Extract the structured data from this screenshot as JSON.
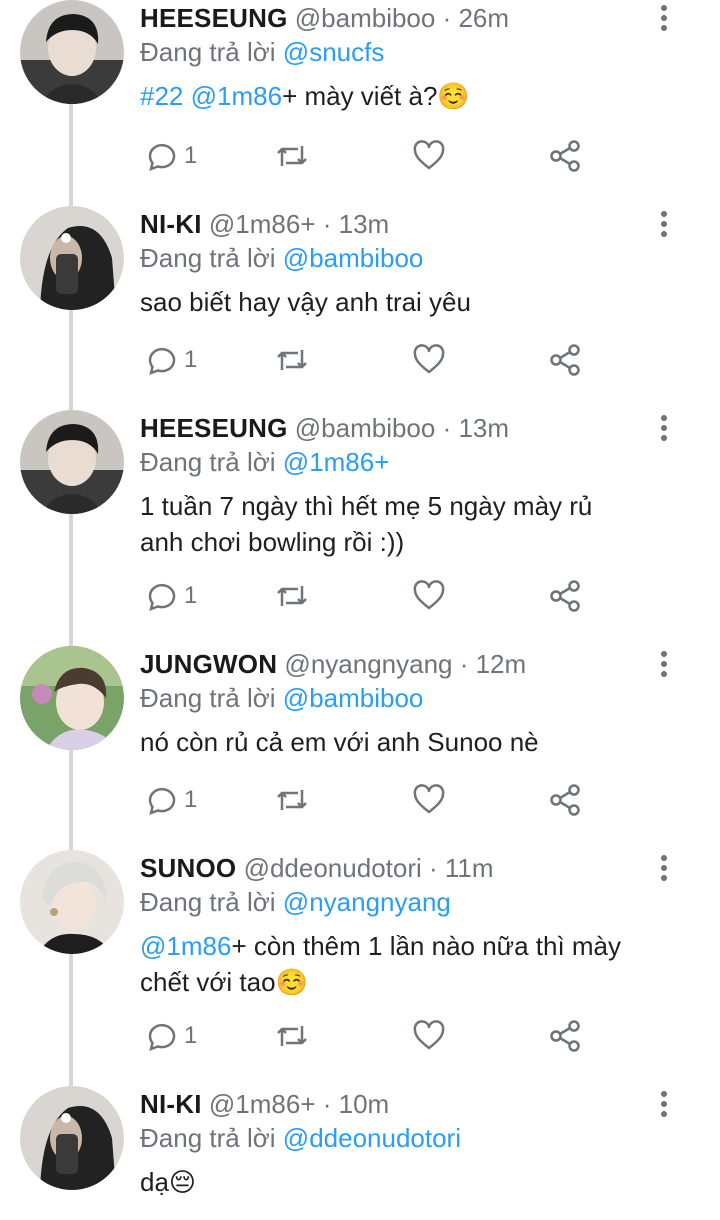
{
  "tweets": [
    {
      "name": "HEESEUNG",
      "handle": "@bambiboo · 26m",
      "reply_prefix": "Đang trả lời",
      "reply_to": "@snucfs",
      "body_hashtag": "#22",
      "body_mention": "@1m86",
      "body_text": "+ mày viết à?☺️",
      "reply_count": "1",
      "avatar": "person-avatar"
    },
    {
      "name": "NI-KI",
      "handle": "@1m86+ · 13m",
      "reply_prefix": "Đang trả lời",
      "reply_to": "@bambiboo",
      "body_text": "sao biết hay vậy anh trai yêu",
      "reply_count": "1",
      "avatar": "person-avatar"
    },
    {
      "name": "HEESEUNG",
      "handle": "@bambiboo · 13m",
      "reply_prefix": "Đang trả lời",
      "reply_to": "@1m86+",
      "body_line1": "1 tuần 7 ngày thì hết mẹ 5 ngày mày rủ",
      "body_line2": "anh chơi bowling rồi :))",
      "reply_count": "1",
      "avatar": "person-avatar"
    },
    {
      "name": "JUNGWON",
      "handle": "@nyangnyang · 12m",
      "reply_prefix": "Đang trả lời",
      "reply_to": "@bambiboo",
      "body_text": "nó còn rủ cả em với anh Sunoo nè",
      "reply_count": "1",
      "avatar": "person-avatar"
    },
    {
      "name": "SUNOO",
      "handle": "@ddeonudotori · 11m",
      "reply_prefix": "Đang trả lời",
      "reply_to": "@nyangnyang",
      "body_mention": "@1m86",
      "body_line1": "+ còn thêm 1 lần nào nữa thì mày",
      "body_line2": "chết với tao☺️",
      "reply_count": "1",
      "avatar": "person-avatar"
    },
    {
      "name": "NI-KI",
      "handle": "@1m86+ · 10m",
      "reply_prefix": "Đang trả lời",
      "reply_to": "@ddeonudotori",
      "body_text": "dạ😔",
      "avatar": "person-avatar"
    }
  ],
  "icons": {
    "reply": "reply-bubble-icon",
    "retweet": "retweet-icon",
    "like": "heart-icon",
    "share": "share-icon",
    "menu": "more-vertical-icon"
  },
  "colors": {
    "mention": "#2a9df4",
    "muted": "#6e7479",
    "text": "#1f1f1f"
  }
}
